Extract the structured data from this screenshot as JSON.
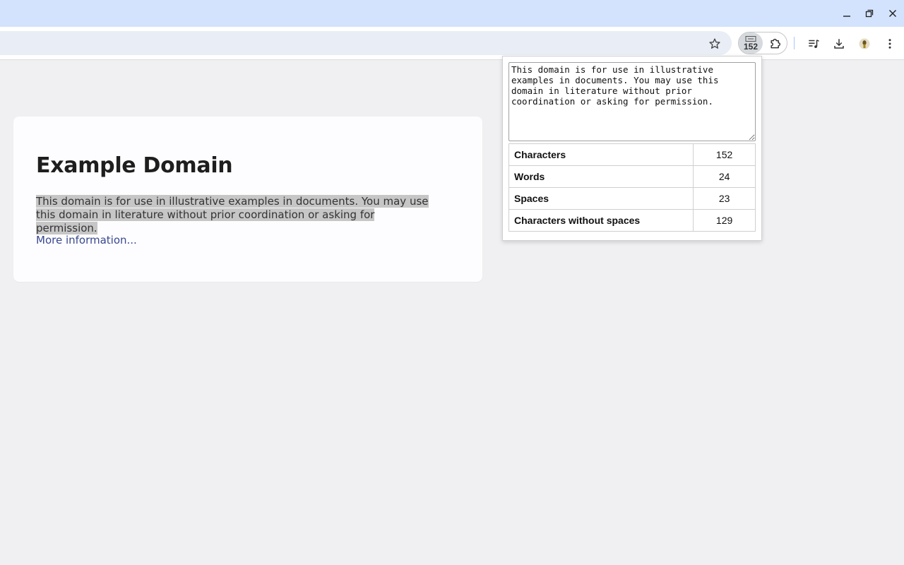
{
  "extension": {
    "badge": "152",
    "textarea_value": "This domain is for use in illustrative examples in documents. You may use this domain in literature without prior coordination or asking for permission.",
    "stats": [
      {
        "label": "Characters",
        "value": "152"
      },
      {
        "label": "Words",
        "value": "24"
      },
      {
        "label": "Spaces",
        "value": "23"
      },
      {
        "label": "Characters without spaces",
        "value": "129"
      }
    ]
  },
  "page": {
    "heading": "Example Domain",
    "description": "This domain is for use in illustrative examples in documents. You may use this domain in literature without prior coordination or asking for permission.",
    "link_text": "More information..."
  },
  "colors": {
    "titlebar": "#d3e3fd",
    "omnibox": "#e9eef6",
    "link": "#38488f",
    "selection": "#c6c6c6"
  }
}
